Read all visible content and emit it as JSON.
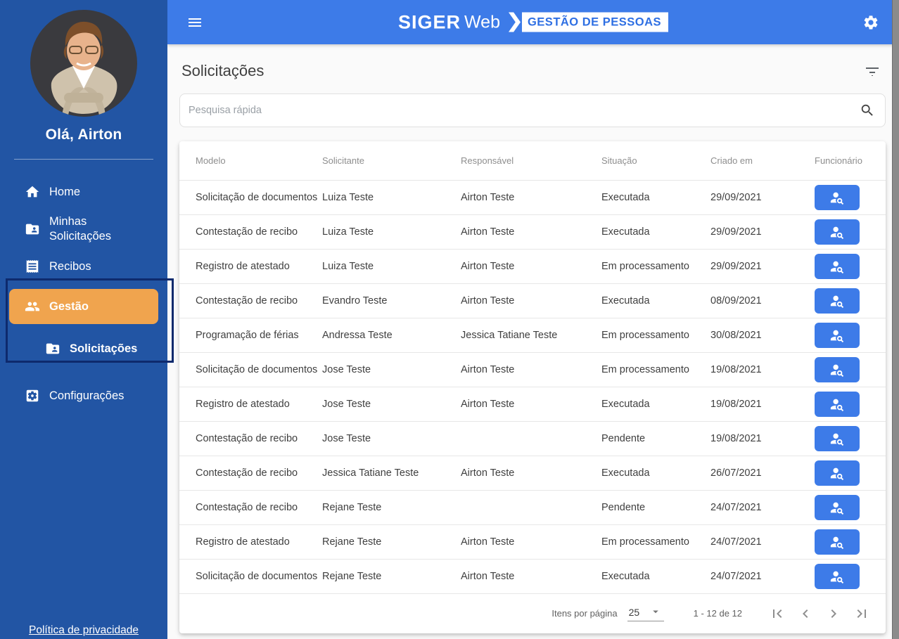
{
  "header": {
    "logo_siger": "SIGER",
    "logo_web": "Web",
    "logo_badge": "GESTÃO DE PESSOAS"
  },
  "sidebar": {
    "greeting": "Olá, Airton",
    "items": [
      {
        "label": "Home",
        "icon": "home-icon"
      },
      {
        "label": "Minhas Solicitações",
        "icon": "folder-shared-icon"
      },
      {
        "label": "Recibos",
        "icon": "receipt-icon"
      },
      {
        "label": "Gestão",
        "icon": "people-icon",
        "active": true
      },
      {
        "label": "Solicitações",
        "icon": "folder-shared-icon",
        "submenu": true
      },
      {
        "label": "Configurações",
        "icon": "settings-box-icon"
      }
    ],
    "privacy_link": "Política de privacidade"
  },
  "main": {
    "title": "Solicitações",
    "search": {
      "placeholder": "Pesquisa rápida"
    },
    "table": {
      "columns": [
        "Modelo",
        "Solicitante",
        "Responsável",
        "Situação",
        "Criado em",
        "Funcionário"
      ],
      "rows": [
        {
          "modelo": "Solicitação de documentos",
          "solicitante": "Luiza Teste",
          "responsavel": "Airton Teste",
          "situacao": "Executada",
          "criado_em": "29/09/2021"
        },
        {
          "modelo": "Contestação de recibo",
          "solicitante": "Luiza Teste",
          "responsavel": "Airton Teste",
          "situacao": "Executada",
          "criado_em": "29/09/2021"
        },
        {
          "modelo": "Registro de atestado",
          "solicitante": "Luiza Teste",
          "responsavel": "Airton Teste",
          "situacao": "Em processamento",
          "criado_em": "29/09/2021"
        },
        {
          "modelo": "Contestação de recibo",
          "solicitante": "Evandro Teste",
          "responsavel": "Airton Teste",
          "situacao": "Executada",
          "criado_em": "08/09/2021"
        },
        {
          "modelo": "Programação de férias",
          "solicitante": "Andressa Teste",
          "responsavel": "Jessica Tatiane Teste",
          "situacao": "Em processamento",
          "criado_em": "30/08/2021"
        },
        {
          "modelo": "Solicitação de documentos",
          "solicitante": "Jose Teste",
          "responsavel": "Airton Teste",
          "situacao": "Em processamento",
          "criado_em": "19/08/2021"
        },
        {
          "modelo": "Registro de atestado",
          "solicitante": "Jose Teste",
          "responsavel": "Airton Teste",
          "situacao": "Executada",
          "criado_em": "19/08/2021"
        },
        {
          "modelo": "Contestação de recibo",
          "solicitante": "Jose Teste",
          "responsavel": "",
          "situacao": "Pendente",
          "criado_em": "19/08/2021"
        },
        {
          "modelo": "Contestação de recibo",
          "solicitante": "Jessica Tatiane Teste",
          "responsavel": "Airton Teste",
          "situacao": "Executada",
          "criado_em": "26/07/2021"
        },
        {
          "modelo": "Contestação de recibo",
          "solicitante": "Rejane Teste",
          "responsavel": "",
          "situacao": "Pendente",
          "criado_em": "24/07/2021"
        },
        {
          "modelo": "Registro de atestado",
          "solicitante": "Rejane Teste",
          "responsavel": "Airton Teste",
          "situacao": "Em processamento",
          "criado_em": "24/07/2021"
        },
        {
          "modelo": "Solicitação de documentos",
          "solicitante": "Rejane Teste",
          "responsavel": "Airton Teste",
          "situacao": "Executada",
          "criado_em": "24/07/2021"
        }
      ]
    },
    "pagination": {
      "items_per_page_label": "Itens por página",
      "items_per_page_value": "25",
      "range_label": "1 - 12 de 12"
    }
  },
  "colors": {
    "header_blue": "#3d7be8",
    "sidebar_blue": "#2255a4",
    "active_item_orange": "#f0a44e",
    "annotation_box_navy": "#0e2a6d",
    "badge_text_blue": "#2e6fe3"
  }
}
